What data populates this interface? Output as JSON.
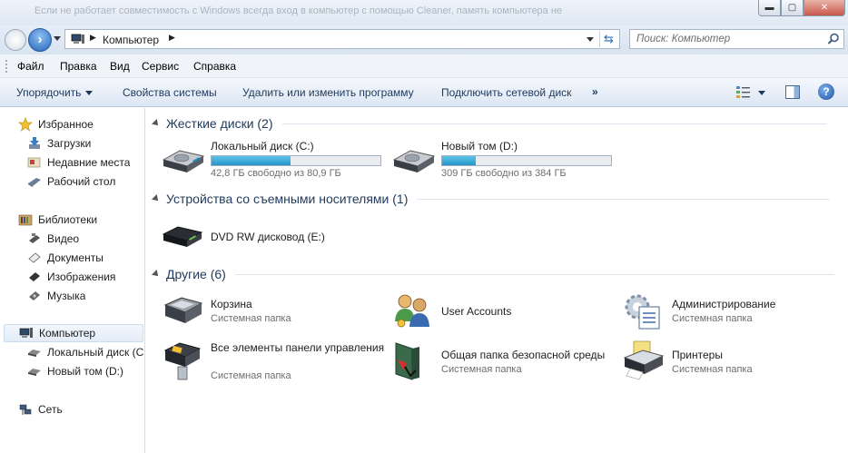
{
  "window": {
    "title": "Если не работает совместимость с Windows всегда вход в компьютер с помощью Cleaner, память компьютера не",
    "min_label": "▬",
    "max_label": "▢",
    "close_label": "✕"
  },
  "address": {
    "path": "Компьютер",
    "search_placeholder": "Поиск: Компьютер"
  },
  "menu": {
    "items": [
      "Файл",
      "Правка",
      "Вид",
      "Сервис",
      "Справка"
    ]
  },
  "commands": {
    "organize": "Упорядочить",
    "system_properties": "Свойства системы",
    "uninstall": "Удалить или изменить программу",
    "map_drive": "Подключить сетевой диск",
    "more": "»",
    "help": "?"
  },
  "nav": {
    "favorites": "Избранное",
    "downloads": "Загрузки",
    "recent": "Недавние места",
    "desktop": "Рабочий стол",
    "libraries": "Библиотеки",
    "video": "Видео",
    "documents": "Документы",
    "pictures": "Изображения",
    "music": "Музыка",
    "computer": "Компьютер",
    "local_c": "Локальный диск (C",
    "new_d": "Новый том (D:)",
    "network": "Сеть"
  },
  "groups": {
    "hdd": "Жесткие диски (2)",
    "removable": "Устройства со съемными носителями (1)",
    "other": "Другие (6)"
  },
  "drives": [
    {
      "name": "Локальный диск (C:)",
      "free": "42,8 ГБ свободно из 80,9 ГБ",
      "used_fraction": 0.47
    },
    {
      "name": "Новый том (D:)",
      "free": "309 ГБ свободно из 384 ГБ",
      "used_fraction": 0.2
    }
  ],
  "removable": {
    "dvd": "DVD RW дисковод (E:)"
  },
  "other_items": {
    "recycle": {
      "name": "Корзина",
      "sub": "Системная папка"
    },
    "user_accounts": {
      "name": "User Accounts"
    },
    "admin": {
      "name": "Администрирование",
      "sub": "Системная папка"
    },
    "control_panel": {
      "name": "Все элементы панели управления",
      "sub": "Системная папка"
    },
    "shared": {
      "name": "Общая папка безопасной среды",
      "sub": "Системная папка"
    },
    "printers": {
      "name": "Принтеры",
      "sub": "Системная папка"
    }
  },
  "colors": {
    "accent": "#1e395b",
    "bar_fill": "#2595c6"
  }
}
